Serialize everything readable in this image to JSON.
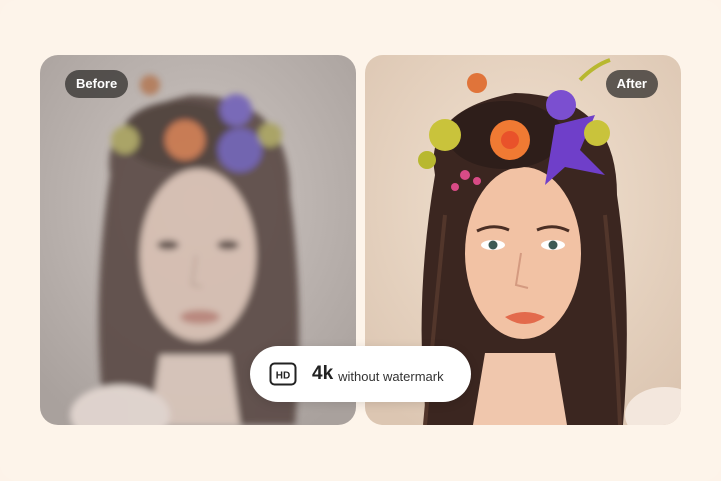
{
  "before_panel": {
    "label": "Before"
  },
  "after_panel": {
    "label": "After"
  },
  "badge": {
    "icon": "hd-icon",
    "icon_text": "HD",
    "resolution": "4k",
    "caption": "without watermark"
  },
  "colors": {
    "background": "#fdf4ea",
    "pill_background": "#3a3634",
    "badge_background": "#ffffff"
  }
}
